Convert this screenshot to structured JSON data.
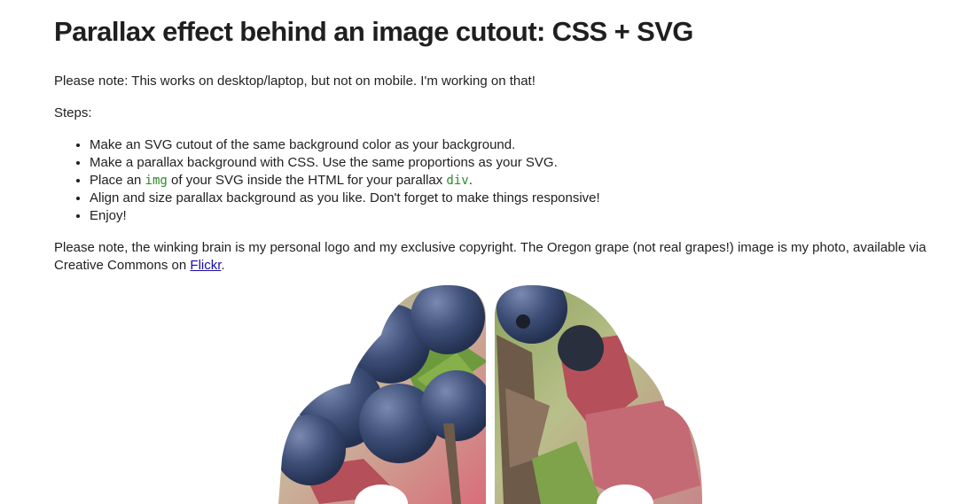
{
  "title": "Parallax effect behind an image cutout: CSS + SVG",
  "note_mobile": "Please note: This works on desktop/laptop, but not on mobile. I'm working on that!",
  "steps_label": "Steps:",
  "steps": {
    "s1": "Make an SVG cutout of the same background color as your background.",
    "s2": "Make a parallax background with CSS. Use the same proportions as your SVG.",
    "s3_a": "Place an ",
    "s3_code1": "img",
    "s3_b": " of your SVG inside the HTML for your parallax ",
    "s3_code2": "div",
    "s3_c": ".",
    "s4": "Align and size parallax background as you like. Don't forget to make things responsive!",
    "s5": "Enjoy!"
  },
  "note_copyright": {
    "text": "Please note, the winking brain is my personal logo and my exclusive copyright. The Oregon grape (not real grapes!) image is my photo, available via Creative Commons on ",
    "link": "Flickr",
    "end": "."
  },
  "colors": {
    "berry": "#3e4f78",
    "leaf": "#6d9a3c",
    "stem": "#6e5a48",
    "red_leaf": "#b5505a",
    "background": "#ffffff"
  }
}
